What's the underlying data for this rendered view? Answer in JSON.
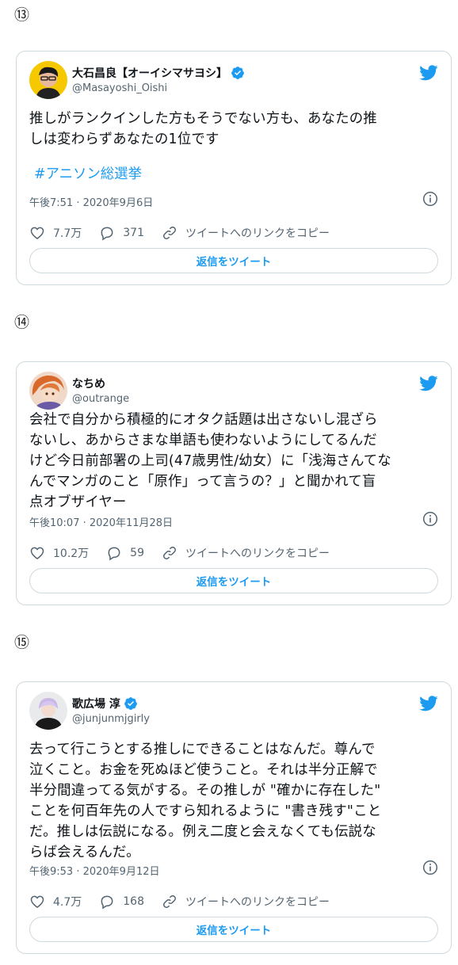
{
  "tweets": [
    {
      "index_label": "⑬",
      "name": "大石昌良【オーイシマサヨシ】",
      "handle": "@Masayoshi_Oishi",
      "text_lines": [
        "推しがランクインした方もそうでない方も、あなたの推",
        "しは変わらずあなたの1位です"
      ],
      "hashtag": "#アニソン総選挙",
      "timestamp": "午後7:51 · 2020年9月6日",
      "likes": "7.7万",
      "replies": "371",
      "copy_link": "ツイートへのリンクをコピー",
      "reply_button": "返信をツイート",
      "verified": true
    },
    {
      "index_label": "⑭",
      "name": "なちめ",
      "handle": "@outrange",
      "text_lines": [
        "会社で自分から積極的にオタク話題は出さないし混ざら",
        "ないし、あからさまな単語も使わないようにしてるんだ",
        "けど今日前部署の上司(47歳男性/幼女）に「浅海さんてな",
        "んでマンガのこと「原作」って言うの？」と聞かれて盲",
        "点オブザイヤー"
      ],
      "timestamp": "午後10:07 · 2020年11月28日",
      "likes": "10.2万",
      "replies": "59",
      "copy_link": "ツイートへのリンクをコピー",
      "reply_button": "返信をツイート",
      "verified": false
    },
    {
      "index_label": "⑮",
      "name": "歌広場 淳",
      "handle": "@junjunmjgirly",
      "text_lines": [
        "去って行こうとする推しにできることはなんだ。尊んで",
        "泣くこと。お金を死ぬほど使うこと。それは半分正解で",
        "半分間違ってる気がする。その推しが \"確かに存在した\"",
        "ことを何百年先の人ですら知れるように \"書き残す\"こと",
        "だ。推しは伝説になる。例え二度と会えなくても伝説な",
        "らば会えるんだ。"
      ],
      "timestamp": "午後9:53 · 2020年9月12日",
      "likes": "4.7万",
      "replies": "168",
      "copy_link": "ツイートへのリンクをコピー",
      "reply_button": "返信をツイート",
      "verified": true
    }
  ],
  "colors": {
    "accent": "#1d9bf0",
    "text": "#0f1419",
    "muted": "#536471",
    "border": "#cfd9de"
  }
}
